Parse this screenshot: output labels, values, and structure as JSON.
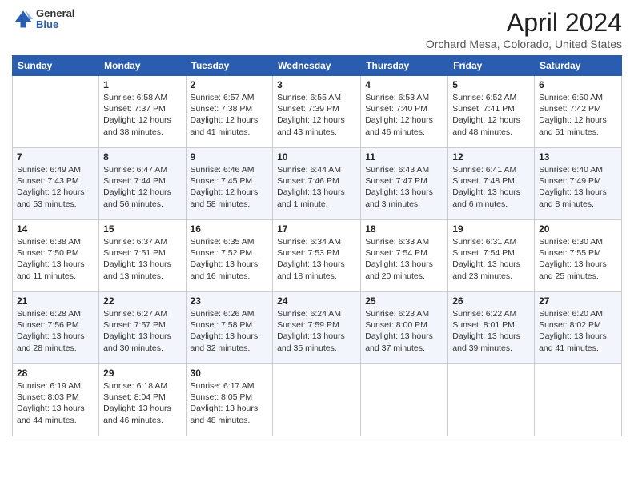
{
  "header": {
    "logo": {
      "line1": "General",
      "line2": "Blue"
    },
    "title": "April 2024",
    "subtitle": "Orchard Mesa, Colorado, United States"
  },
  "days_of_week": [
    "Sunday",
    "Monday",
    "Tuesday",
    "Wednesday",
    "Thursday",
    "Friday",
    "Saturday"
  ],
  "weeks": [
    [
      {
        "day": "",
        "sunrise": "",
        "sunset": "",
        "daylight": ""
      },
      {
        "day": "1",
        "sunrise": "Sunrise: 6:58 AM",
        "sunset": "Sunset: 7:37 PM",
        "daylight": "Daylight: 12 hours and 38 minutes."
      },
      {
        "day": "2",
        "sunrise": "Sunrise: 6:57 AM",
        "sunset": "Sunset: 7:38 PM",
        "daylight": "Daylight: 12 hours and 41 minutes."
      },
      {
        "day": "3",
        "sunrise": "Sunrise: 6:55 AM",
        "sunset": "Sunset: 7:39 PM",
        "daylight": "Daylight: 12 hours and 43 minutes."
      },
      {
        "day": "4",
        "sunrise": "Sunrise: 6:53 AM",
        "sunset": "Sunset: 7:40 PM",
        "daylight": "Daylight: 12 hours and 46 minutes."
      },
      {
        "day": "5",
        "sunrise": "Sunrise: 6:52 AM",
        "sunset": "Sunset: 7:41 PM",
        "daylight": "Daylight: 12 hours and 48 minutes."
      },
      {
        "day": "6",
        "sunrise": "Sunrise: 6:50 AM",
        "sunset": "Sunset: 7:42 PM",
        "daylight": "Daylight: 12 hours and 51 minutes."
      }
    ],
    [
      {
        "day": "7",
        "sunrise": "Sunrise: 6:49 AM",
        "sunset": "Sunset: 7:43 PM",
        "daylight": "Daylight: 12 hours and 53 minutes."
      },
      {
        "day": "8",
        "sunrise": "Sunrise: 6:47 AM",
        "sunset": "Sunset: 7:44 PM",
        "daylight": "Daylight: 12 hours and 56 minutes."
      },
      {
        "day": "9",
        "sunrise": "Sunrise: 6:46 AM",
        "sunset": "Sunset: 7:45 PM",
        "daylight": "Daylight: 12 hours and 58 minutes."
      },
      {
        "day": "10",
        "sunrise": "Sunrise: 6:44 AM",
        "sunset": "Sunset: 7:46 PM",
        "daylight": "Daylight: 13 hours and 1 minute."
      },
      {
        "day": "11",
        "sunrise": "Sunrise: 6:43 AM",
        "sunset": "Sunset: 7:47 PM",
        "daylight": "Daylight: 13 hours and 3 minutes."
      },
      {
        "day": "12",
        "sunrise": "Sunrise: 6:41 AM",
        "sunset": "Sunset: 7:48 PM",
        "daylight": "Daylight: 13 hours and 6 minutes."
      },
      {
        "day": "13",
        "sunrise": "Sunrise: 6:40 AM",
        "sunset": "Sunset: 7:49 PM",
        "daylight": "Daylight: 13 hours and 8 minutes."
      }
    ],
    [
      {
        "day": "14",
        "sunrise": "Sunrise: 6:38 AM",
        "sunset": "Sunset: 7:50 PM",
        "daylight": "Daylight: 13 hours and 11 minutes."
      },
      {
        "day": "15",
        "sunrise": "Sunrise: 6:37 AM",
        "sunset": "Sunset: 7:51 PM",
        "daylight": "Daylight: 13 hours and 13 minutes."
      },
      {
        "day": "16",
        "sunrise": "Sunrise: 6:35 AM",
        "sunset": "Sunset: 7:52 PM",
        "daylight": "Daylight: 13 hours and 16 minutes."
      },
      {
        "day": "17",
        "sunrise": "Sunrise: 6:34 AM",
        "sunset": "Sunset: 7:53 PM",
        "daylight": "Daylight: 13 hours and 18 minutes."
      },
      {
        "day": "18",
        "sunrise": "Sunrise: 6:33 AM",
        "sunset": "Sunset: 7:54 PM",
        "daylight": "Daylight: 13 hours and 20 minutes."
      },
      {
        "day": "19",
        "sunrise": "Sunrise: 6:31 AM",
        "sunset": "Sunset: 7:54 PM",
        "daylight": "Daylight: 13 hours and 23 minutes."
      },
      {
        "day": "20",
        "sunrise": "Sunrise: 6:30 AM",
        "sunset": "Sunset: 7:55 PM",
        "daylight": "Daylight: 13 hours and 25 minutes."
      }
    ],
    [
      {
        "day": "21",
        "sunrise": "Sunrise: 6:28 AM",
        "sunset": "Sunset: 7:56 PM",
        "daylight": "Daylight: 13 hours and 28 minutes."
      },
      {
        "day": "22",
        "sunrise": "Sunrise: 6:27 AM",
        "sunset": "Sunset: 7:57 PM",
        "daylight": "Daylight: 13 hours and 30 minutes."
      },
      {
        "day": "23",
        "sunrise": "Sunrise: 6:26 AM",
        "sunset": "Sunset: 7:58 PM",
        "daylight": "Daylight: 13 hours and 32 minutes."
      },
      {
        "day": "24",
        "sunrise": "Sunrise: 6:24 AM",
        "sunset": "Sunset: 7:59 PM",
        "daylight": "Daylight: 13 hours and 35 minutes."
      },
      {
        "day": "25",
        "sunrise": "Sunrise: 6:23 AM",
        "sunset": "Sunset: 8:00 PM",
        "daylight": "Daylight: 13 hours and 37 minutes."
      },
      {
        "day": "26",
        "sunrise": "Sunrise: 6:22 AM",
        "sunset": "Sunset: 8:01 PM",
        "daylight": "Daylight: 13 hours and 39 minutes."
      },
      {
        "day": "27",
        "sunrise": "Sunrise: 6:20 AM",
        "sunset": "Sunset: 8:02 PM",
        "daylight": "Daylight: 13 hours and 41 minutes."
      }
    ],
    [
      {
        "day": "28",
        "sunrise": "Sunrise: 6:19 AM",
        "sunset": "Sunset: 8:03 PM",
        "daylight": "Daylight: 13 hours and 44 minutes."
      },
      {
        "day": "29",
        "sunrise": "Sunrise: 6:18 AM",
        "sunset": "Sunset: 8:04 PM",
        "daylight": "Daylight: 13 hours and 46 minutes."
      },
      {
        "day": "30",
        "sunrise": "Sunrise: 6:17 AM",
        "sunset": "Sunset: 8:05 PM",
        "daylight": "Daylight: 13 hours and 48 minutes."
      },
      {
        "day": "",
        "sunrise": "",
        "sunset": "",
        "daylight": ""
      },
      {
        "day": "",
        "sunrise": "",
        "sunset": "",
        "daylight": ""
      },
      {
        "day": "",
        "sunrise": "",
        "sunset": "",
        "daylight": ""
      },
      {
        "day": "",
        "sunrise": "",
        "sunset": "",
        "daylight": ""
      }
    ]
  ]
}
